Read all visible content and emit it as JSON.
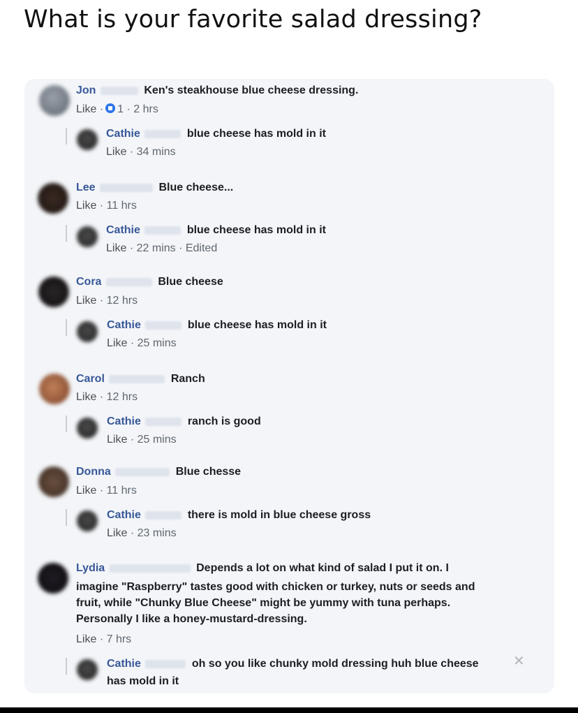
{
  "headline": "What is your favorite salad dressing?",
  "comments": [
    {
      "author": "Jon",
      "text": "Ken's steakhouse blue cheese dressing.",
      "like_label": "Like",
      "reactions": "1",
      "time": "2 hrs",
      "reply": {
        "author": "Cathie",
        "text": "blue cheese has mold in it",
        "like_label": "Like",
        "time": "34 mins"
      }
    },
    {
      "author": "Lee",
      "text": "Blue cheese...",
      "like_label": "Like",
      "time": "11 hrs",
      "reply": {
        "author": "Cathie",
        "text": "blue cheese has mold in it",
        "like_label": "Like",
        "time": "22 mins",
        "edited": "Edited"
      }
    },
    {
      "author": "Cora",
      "text": "Blue cheese",
      "like_label": "Like",
      "time": "12 hrs",
      "reply": {
        "author": "Cathie",
        "text": "blue cheese has mold in it",
        "like_label": "Like",
        "time": "25 mins"
      }
    },
    {
      "author": "Carol",
      "text": "Ranch",
      "like_label": "Like",
      "time": "12 hrs",
      "reply": {
        "author": "Cathie",
        "text": "ranch is good",
        "like_label": "Like",
        "time": "25 mins"
      }
    },
    {
      "author": "Donna",
      "text": "Blue chesse",
      "like_label": "Like",
      "time": "11 hrs",
      "reply": {
        "author": "Cathie",
        "text": "there is mold in blue cheese gross",
        "like_label": "Like",
        "time": "23 mins"
      }
    },
    {
      "author": "Lydia",
      "text_first": "Depends a lot on what kind of salad I put it on. I",
      "text_lines": [
        "imagine \"Raspberry\" tastes good with chicken or turkey, nuts or seeds and",
        "fruit, while \"Chunky Blue Cheese\" might be yummy with tuna perhaps.",
        "Personally I like a honey-mustard-dressing."
      ],
      "like_label": "Like",
      "time": "7 hrs",
      "reply": {
        "author": "Cathie",
        "text": "oh so you like chunky mold dressing huh blue cheese",
        "text_cont": "has mold in it"
      }
    }
  ],
  "separator": "·",
  "colors": {
    "author": "#385898",
    "panel": "#f3f5f8",
    "like_badge": "#2d75e8"
  },
  "icons": {
    "close": "close-icon",
    "like_reaction": "like-reaction-icon"
  }
}
